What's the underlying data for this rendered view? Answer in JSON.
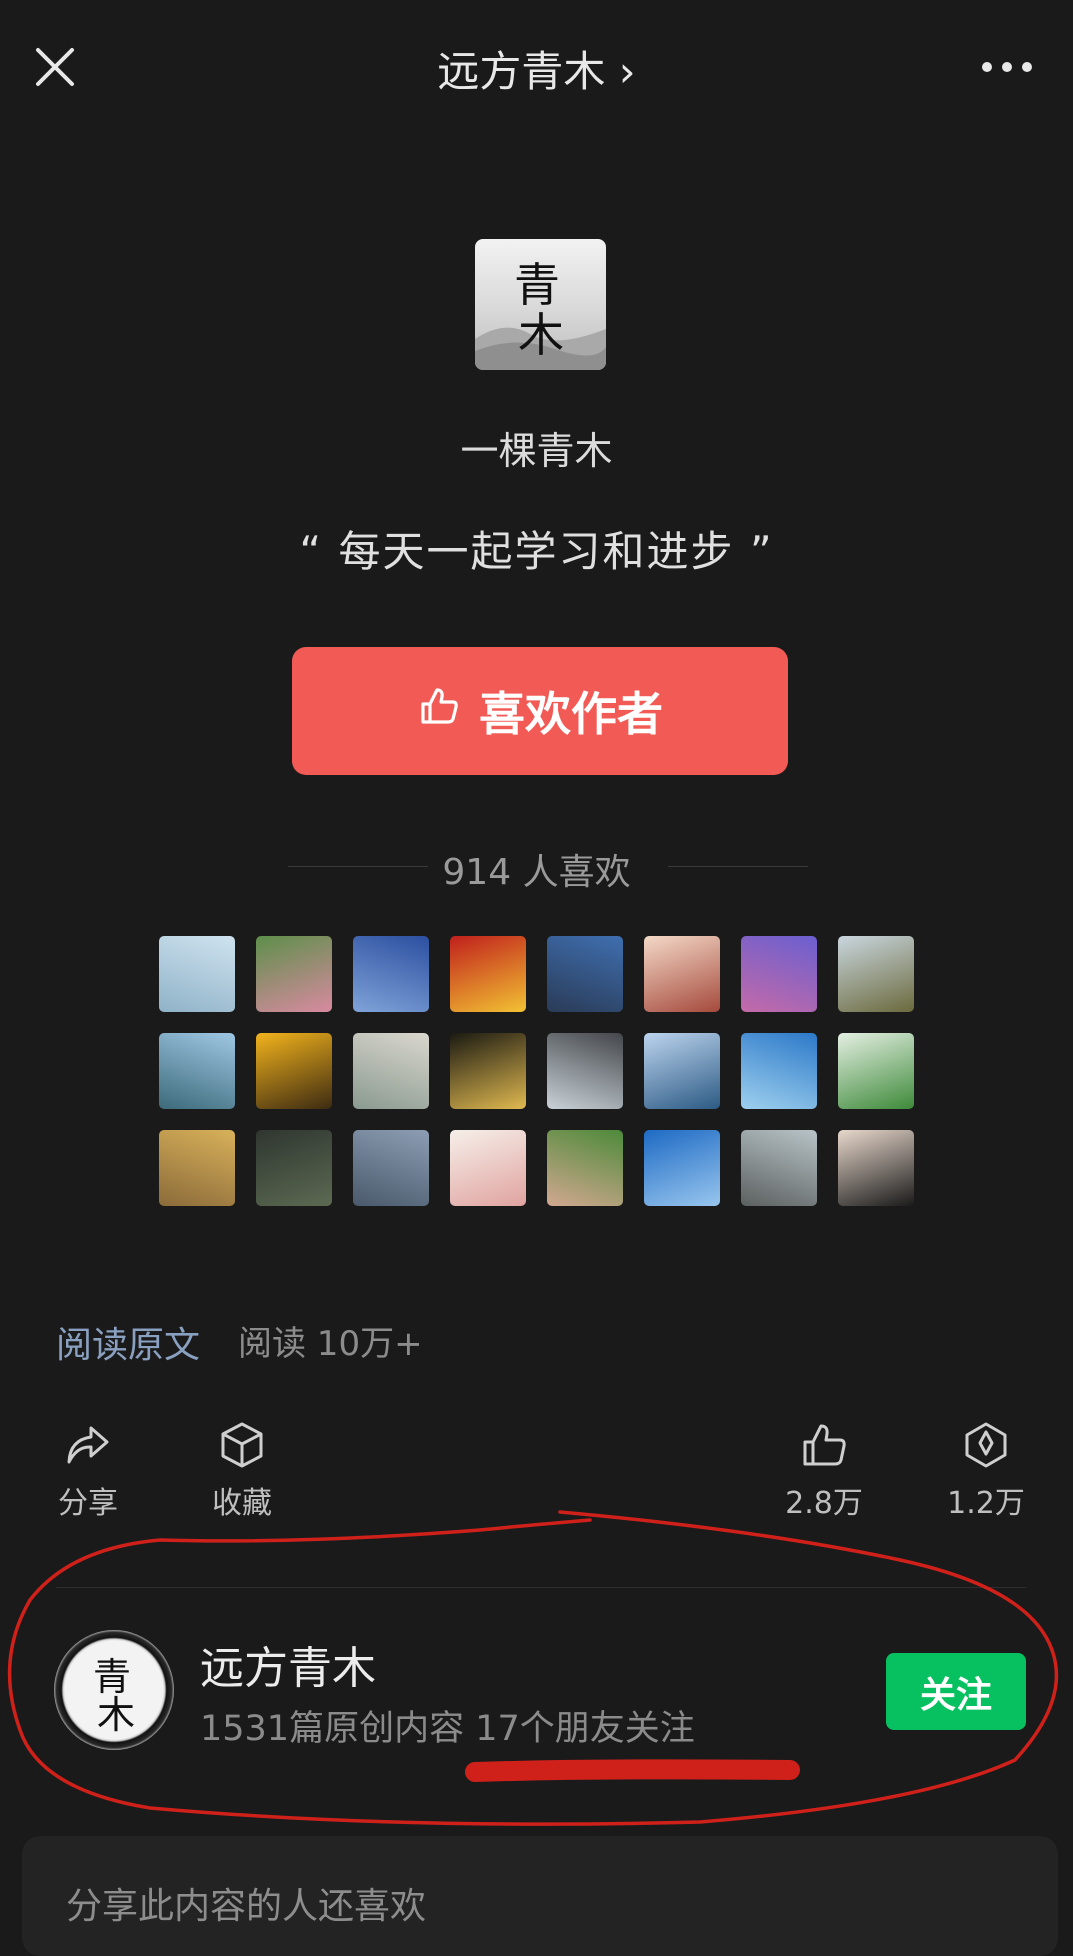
{
  "header": {
    "title": "远方青木 ›",
    "close_icon": "close-icon",
    "more_icon": "more-icon"
  },
  "profile": {
    "logo_text": "青木",
    "author_name": "一棵青木",
    "quote": "“ 每天一起学习和进步 ”"
  },
  "like_button": {
    "label": "喜欢作者",
    "icon": "thumbs-up-icon",
    "color": "#f25a55"
  },
  "likes": {
    "count_label": "914 人喜欢"
  },
  "liker_avatars": [
    {
      "colors": [
        "#cfe3ef",
        "#8fb2c8"
      ]
    },
    {
      "colors": [
        "#5d8f4a",
        "#d88aa0"
      ]
    },
    {
      "colors": [
        "#2c4fa0",
        "#7fa3d8"
      ]
    },
    {
      "colors": [
        "#c0201c",
        "#f2c233"
      ]
    },
    {
      "colors": [
        "#3f6fb0",
        "#2a3b57"
      ]
    },
    {
      "colors": [
        "#f4d9c8",
        "#a54a3c"
      ]
    },
    {
      "colors": [
        "#6a5fd0",
        "#c46aa8"
      ]
    },
    {
      "colors": [
        "#c9d6de",
        "#6b6a3d"
      ]
    },
    {
      "colors": [
        "#9fc7e4",
        "#3c6a7a"
      ]
    },
    {
      "colors": [
        "#f2b31c",
        "#3d2b12"
      ]
    },
    {
      "colors": [
        "#dad7ce",
        "#8a9a90"
      ]
    },
    {
      "colors": [
        "#1b1a12",
        "#e0b950"
      ]
    },
    {
      "colors": [
        "#43464a",
        "#c9d2d8"
      ]
    },
    {
      "colors": [
        "#bcd4ee",
        "#2c5a84"
      ]
    },
    {
      "colors": [
        "#2c79c9",
        "#9ed0ee"
      ]
    },
    {
      "colors": [
        "#e4efe2",
        "#3e8a3a"
      ]
    },
    {
      "colors": [
        "#d8b15a",
        "#8b6b3a"
      ]
    },
    {
      "colors": [
        "#2f3630",
        "#5c6a52"
      ]
    },
    {
      "colors": [
        "#8d9db3",
        "#4a5a6c"
      ]
    },
    {
      "colors": [
        "#f6efe9",
        "#e0a3a0"
      ]
    },
    {
      "colors": [
        "#4d8a3a",
        "#d2a890"
      ]
    },
    {
      "colors": [
        "#1e6ac4",
        "#98c6ee"
      ]
    },
    {
      "colors": [
        "#b8c4c8",
        "#5c6060"
      ]
    },
    {
      "colors": [
        "#e8d8cc",
        "#1a1a1a"
      ]
    }
  ],
  "article": {
    "read_original": "阅读原文",
    "read_count": "阅读 10万+"
  },
  "actions": {
    "share": {
      "label": "分享",
      "icon": "share-icon"
    },
    "collect": {
      "label": "收藏",
      "icon": "collect-icon"
    },
    "like": {
      "label": "2.8万",
      "icon": "thumbs-up-icon"
    },
    "wow": {
      "label": "1.2万",
      "icon": "wow-icon"
    }
  },
  "account": {
    "name": "远方青木",
    "meta": "1531篇原创内容  17个朋友关注",
    "follow_label": "关注",
    "follow_color": "#07c160"
  },
  "recommend": {
    "title": "分享此内容的人还喜欢"
  },
  "annotations": {
    "ink_color": "#d0201a"
  }
}
